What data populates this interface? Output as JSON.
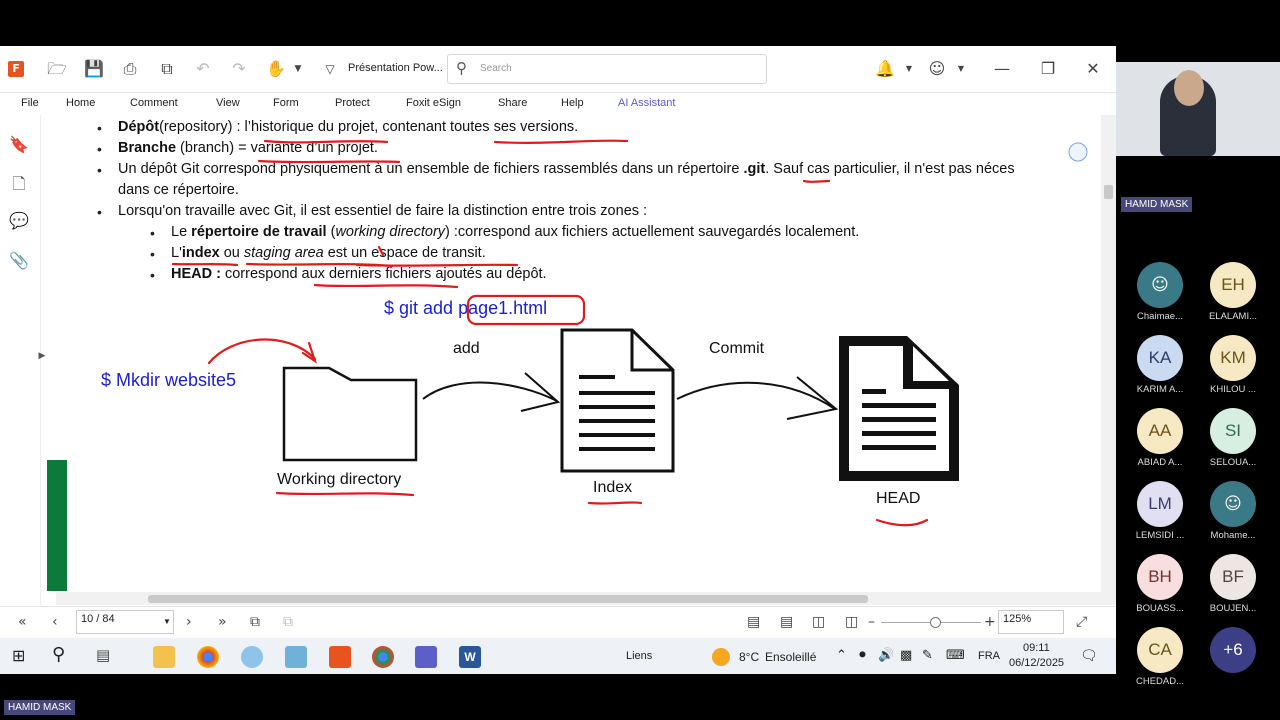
{
  "toolbar": {
    "doc_title": "Présentation Pow...",
    "search_placeholder": "Search"
  },
  "menu": {
    "items": [
      "File",
      "Home",
      "Comment",
      "View",
      "Form",
      "Protect",
      "Foxit eSign",
      "Share",
      "Help"
    ],
    "ai_assistant": "AI Assistant"
  },
  "slide": {
    "b1_bold": "Dépôt",
    "b1_rest": "(repository) : l’historique du projet, contenant toutes ses versions.",
    "b2_bold": "Branche",
    "b2_rest": " (branch) = variante d’un projet.",
    "b3_line1a": "Un dépôt Git correspond physiquement à un ensemble de fichiers rassemblés dans un répertoire ",
    "b3_git": ".git",
    "b3_line1b": ". Sauf cas particulier, il n'est pas néces",
    "b3_line2": "dans ce répertoire.",
    "b4": "Lorsqu'on travaille avec Git, il est essentiel de faire la distinction entre trois zones :",
    "s1_pre": "Le ",
    "s1_bold": "répertoire de travail",
    "s1_mid": " (",
    "s1_italic": "working directory",
    "s1_rest": ") :correspond aux fichiers actuellement sauvegardés localement.",
    "s2_pre": "L'",
    "s2_bold": "index",
    "s2_mid": " ou ",
    "s2_italic": "staging area",
    "s2_rest": " est un espace de transit.",
    "s3_bold": "HEAD :",
    "s3_rest": " correspond aux derniers fichiers ajoutés au dépôt.",
    "git_add": "$ git add ",
    "git_file": "page1.html",
    "mkdir": "$ Mkdir website5",
    "add_label": "add",
    "commit_label": "Commit",
    "working_directory": "Working directory",
    "index_label": "Index",
    "head_label": "HEAD"
  },
  "status": {
    "page": "10 / 84",
    "zoom": "125%"
  },
  "taskbar": {
    "links": "Liens",
    "weather_temp": "8°C",
    "weather_text": "Ensoleillé",
    "lang": "FRA",
    "time": "09:11",
    "date": "06/12/2025"
  },
  "meeting": {
    "presenter_badge": "HAMID MASK",
    "bottom_badge": "HAMID MASK",
    "participants": [
      {
        "initials": "",
        "name": "Chaimae...",
        "bg": "#3a7a86",
        "fg": "#ffffff",
        "icon": "person-icon"
      },
      {
        "initials": "EH",
        "name": "ELALAMI...",
        "bg": "#f6e9c3",
        "fg": "#6b5417"
      },
      {
        "initials": "KA",
        "name": "KARIM A...",
        "bg": "#c9daf1",
        "fg": "#2c3e66"
      },
      {
        "initials": "KM",
        "name": "KHILOU ...",
        "bg": "#f6e9c3",
        "fg": "#6b5417"
      },
      {
        "initials": "AA",
        "name": "ABIAD A...",
        "bg": "#f6e9c3",
        "fg": "#6b5417"
      },
      {
        "initials": "SI",
        "name": "SELOUA...",
        "bg": "#d7efe3",
        "fg": "#2f6b4c"
      },
      {
        "initials": "LM",
        "name": "LEMSIDI ...",
        "bg": "#e1e0f2",
        "fg": "#3c3a6b"
      },
      {
        "initials": "",
        "name": "Mohame...",
        "bg": "#3a7a86",
        "fg": "#ffffff",
        "icon": "person-icon"
      },
      {
        "initials": "BH",
        "name": "BOUASS...",
        "bg": "#f8dede",
        "fg": "#7a3030"
      },
      {
        "initials": "BF",
        "name": "BOUJEN...",
        "bg": "#ece7e2",
        "fg": "#4f4540"
      },
      {
        "initials": "CA",
        "name": "CHEDAD...",
        "bg": "#f6e9c3",
        "fg": "#6b5417"
      },
      {
        "initials": "+6",
        "name": "",
        "bg": "#3c3f86",
        "fg": "#ffffff"
      }
    ]
  }
}
